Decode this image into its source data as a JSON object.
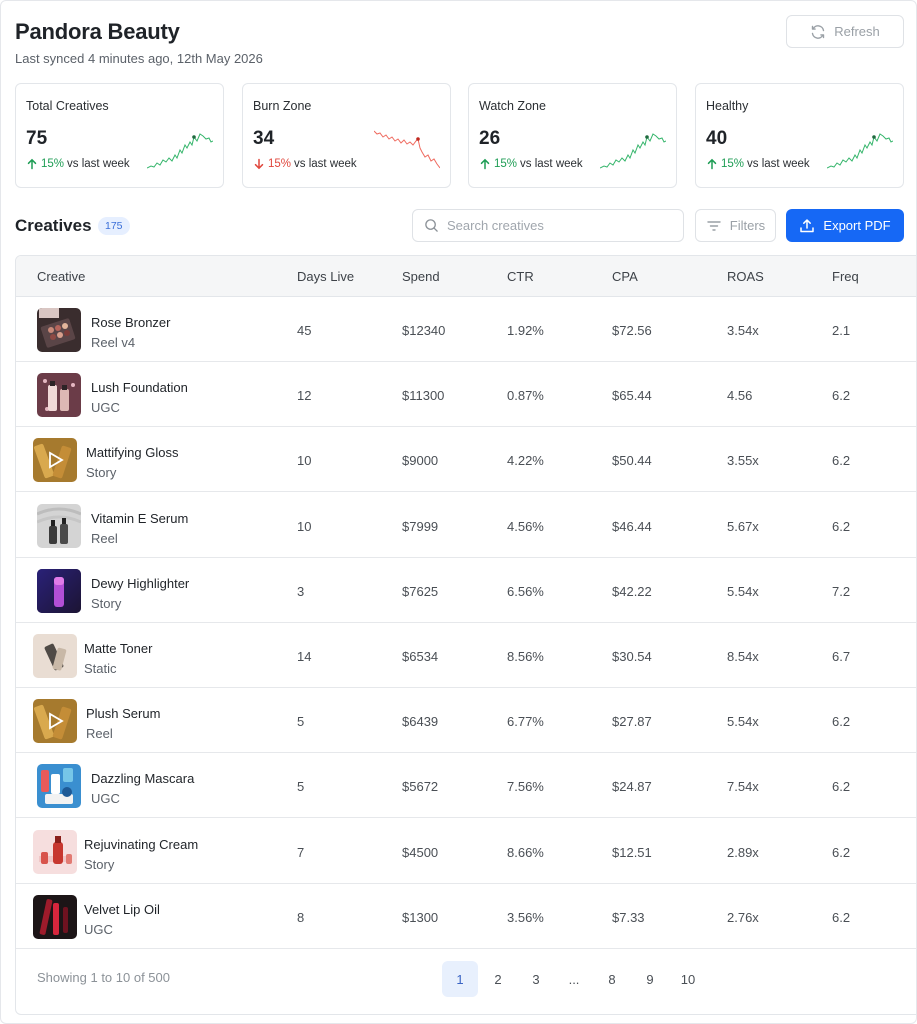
{
  "header": {
    "title": "Pandora Beauty",
    "subtitle": "Last synced 4 minutes ago, 12th May 2026",
    "refresh_label": "Refresh"
  },
  "cards": [
    {
      "label": "Total Creatives",
      "value": "75",
      "pct": "15%",
      "suffix": "vs last week",
      "trend": "up",
      "color": "#1f9d55"
    },
    {
      "label": "Burn Zone",
      "value": "34",
      "pct": "15%",
      "suffix": "vs last week",
      "trend": "down",
      "color": "#e0473d"
    },
    {
      "label": "Watch Zone",
      "value": "26",
      "pct": "15%",
      "suffix": "vs last week",
      "trend": "up",
      "color": "#1f9d55"
    },
    {
      "label": "Healthy",
      "value": "40",
      "pct": "15%",
      "suffix": "vs last week",
      "trend": "up",
      "color": "#1f9d55"
    }
  ],
  "creatives": {
    "title": "Creatives",
    "count": "175",
    "search_placeholder": "Search creatives",
    "filters_label": "Filters",
    "export_label": "Export PDF"
  },
  "table": {
    "columns": [
      "Creative",
      "Days Live",
      "Spend",
      "CTR",
      "CPA",
      "ROAS",
      "Freq"
    ],
    "rows": [
      {
        "name": "Rose Bronzer",
        "type": "Reel v4",
        "days": "45",
        "spend": "$12340",
        "ctr": "1.92%",
        "cpa": "$72.56",
        "roas": "3.54x",
        "freq": "2.1",
        "thumb": "makeup-palette-thumbnail",
        "tag_color": "#fde3d6"
      },
      {
        "name": "Lush Foundation",
        "type": "UGC",
        "days": "12",
        "spend": "$11300",
        "ctr": "0.87%",
        "cpa": "$65.44",
        "roas": "4.56",
        "freq": "6.2",
        "thumb": "foundation-bottles-thumbnail",
        "tag_color": "#fde3d6"
      },
      {
        "name": "Mattifying Gloss",
        "type": "Story",
        "days": "10",
        "spend": "$9000",
        "ctr": "4.22%",
        "cpa": "$50.44",
        "roas": "3.55x",
        "freq": "6.2",
        "thumb": "gloss-video-thumbnail",
        "tag_color": "#eef2ee"
      },
      {
        "name": "Vitamin E Serum",
        "type": "Reel",
        "days": "10",
        "spend": "$7999",
        "ctr": "4.56%",
        "cpa": "$46.44",
        "roas": "5.67x",
        "freq": "6.2",
        "thumb": "serum-bottles-thumbnail",
        "tag_color": "#eef2ee"
      },
      {
        "name": "Dewy Highlighter",
        "type": "Story",
        "days": "3",
        "spend": "$7625",
        "ctr": "6.56%",
        "cpa": "$42.22",
        "roas": "5.54x",
        "freq": "7.2",
        "thumb": "highlighter-tube-thumbnail",
        "tag_color": "#eef2ee"
      },
      {
        "name": "Matte Toner",
        "type": "Static",
        "days": "14",
        "spend": "$6534",
        "ctr": "8.56%",
        "cpa": "$30.54",
        "roas": "8.54x",
        "freq": "6.7",
        "thumb": "toner-thumbnail",
        "tag_color": "#fbe1e4"
      },
      {
        "name": "Plush Serum",
        "type": "Reel",
        "days": "5",
        "spend": "$6439",
        "ctr": "6.77%",
        "cpa": "$27.87",
        "roas": "5.54x",
        "freq": "6.2",
        "thumb": "serum-video-thumbnail",
        "tag_color": "#fbf5d8"
      },
      {
        "name": "Dazzling Mascara",
        "type": "UGC",
        "days": "5",
        "spend": "$5672",
        "ctr": "7.56%",
        "cpa": "$24.87",
        "roas": "7.54x",
        "freq": "6.2",
        "thumb": "mascara-products-thumbnail",
        "tag_color": "#fbf5d8"
      },
      {
        "name": "Rejuvinating Cream",
        "type": "Story",
        "days": "7",
        "spend": "$4500",
        "ctr": "8.66%",
        "cpa": "$12.51",
        "roas": "2.89x",
        "freq": "6.2",
        "thumb": "cream-bottles-thumbnail",
        "tag_color": "#eef2ee"
      },
      {
        "name": "Velvet Lip Oil",
        "type": "UGC",
        "days": "8",
        "spend": "$1300",
        "ctr": "3.56%",
        "cpa": "$7.33",
        "roas": "2.76x",
        "freq": "6.2",
        "thumb": "lip-oil-thumbnail",
        "tag_color": "#eef2ee"
      }
    ]
  },
  "pagination": {
    "summary": "Showing 1 to 10 of 500",
    "pages": [
      "1",
      "2",
      "3",
      "...",
      "8",
      "9",
      "10"
    ],
    "active": "1"
  },
  "colors": {
    "accent": "#1668f5",
    "up": "#1f9d55",
    "down": "#e0473d"
  }
}
